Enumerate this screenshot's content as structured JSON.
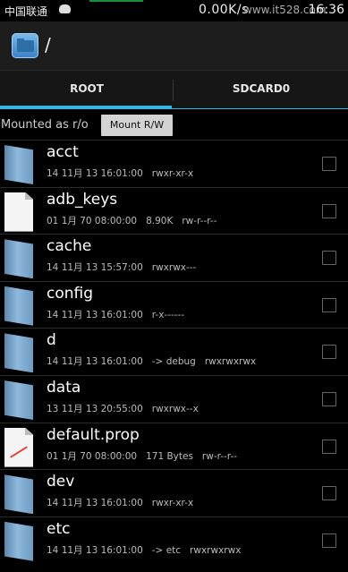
{
  "status_bar": {
    "carrier": "中国联通",
    "speed": "0.00K/s",
    "watermark": "www.it528.com",
    "time": "16:36"
  },
  "action_bar": {
    "path": "/",
    "app_icon": "folder-app-icon"
  },
  "tabs": [
    {
      "label": "ROOT",
      "selected": true
    },
    {
      "label": "SDCARD0",
      "selected": false
    }
  ],
  "mount": {
    "status": "Mounted as r/o",
    "button": "Mount R/W"
  },
  "colors": {
    "accent": "#33b5e5",
    "background": "#000000"
  },
  "files": [
    {
      "name": "acct",
      "icon": "folder-icon",
      "date": "14 11月 13 16:01:00",
      "extra": "",
      "perms": "rwxr-xr-x"
    },
    {
      "name": "adb_keys",
      "icon": "file-icon",
      "date": "01 1月 70 08:00:00",
      "extra": "8.90K",
      "perms": "rw-r--r--"
    },
    {
      "name": "cache",
      "icon": "folder-icon",
      "date": "14 11月 13 15:57:00",
      "extra": "",
      "perms": "rwxrwx---"
    },
    {
      "name": "config",
      "icon": "folder-icon",
      "date": "14 11月 13 16:01:00",
      "extra": "",
      "perms": "r-x------"
    },
    {
      "name": "d",
      "icon": "folder-icon",
      "date": "14 11月 13 16:01:00",
      "extra": "-> debug",
      "perms": "rwxrwxrwx"
    },
    {
      "name": "data",
      "icon": "folder-icon",
      "date": "13 11月 13 20:55:00",
      "extra": "",
      "perms": "rwxrwx--x"
    },
    {
      "name": "default.prop",
      "icon": "prop-file-icon",
      "date": "01 1月 70 08:00:00",
      "extra": "171 Bytes",
      "perms": "rw-r--r--"
    },
    {
      "name": "dev",
      "icon": "folder-icon",
      "date": "14 11月 13 16:01:00",
      "extra": "",
      "perms": "rwxr-xr-x"
    },
    {
      "name": "etc",
      "icon": "folder-icon",
      "date": "14 11月 13 16:01:00",
      "extra": "-> etc",
      "perms": "rwxrwxrwx"
    }
  ]
}
